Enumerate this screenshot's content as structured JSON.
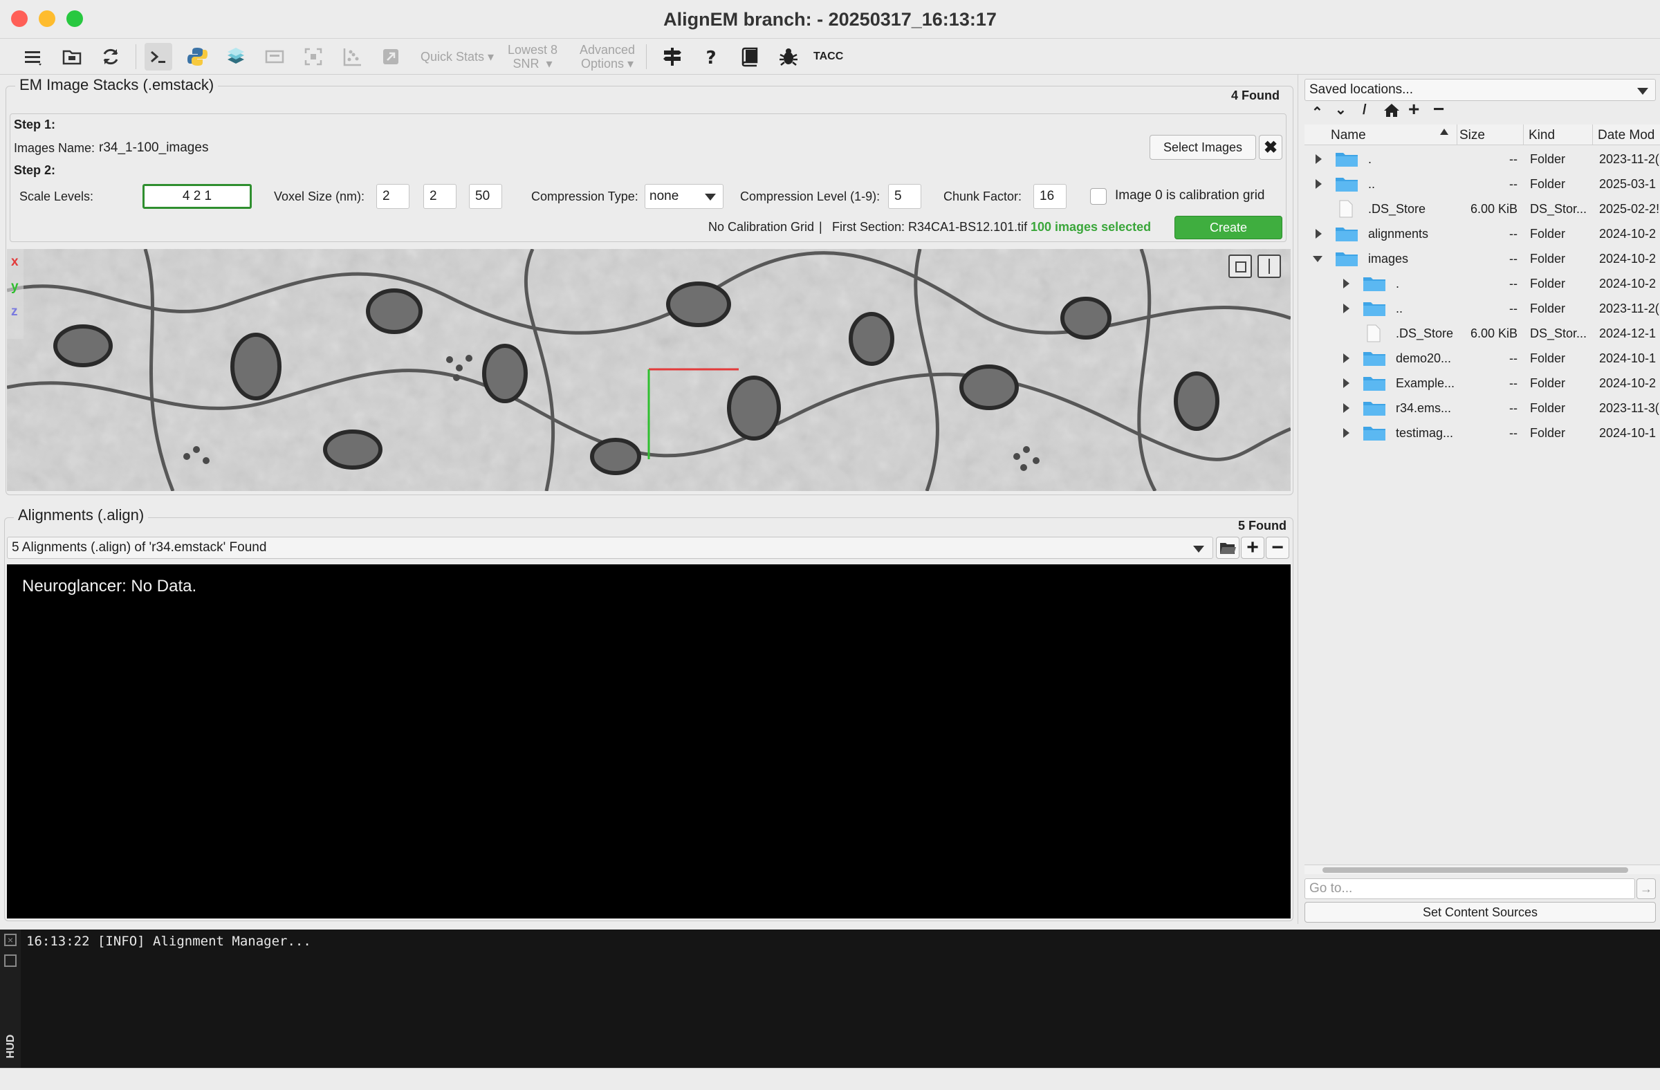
{
  "window": {
    "title": "AlignEM branch:  - 20250317_16:13:17",
    "lights": {
      "close": "#ff5f57",
      "minimize": "#febc2e",
      "maximize": "#28c840"
    }
  },
  "toolbar": {
    "quick_stats": "Quick Stats",
    "lowest_snr_line1": "Lowest 8",
    "lowest_snr_line2": "SNR",
    "advanced_line1": "Advanced",
    "advanced_line2": "Options",
    "tacc": "TACC"
  },
  "emstack": {
    "title": "EM Image Stacks (.emstack)",
    "found": "4 Found",
    "step1": "Step 1:",
    "images_name_label": "Images Name:",
    "images_name_value": "r34_1-100_images",
    "select_images": "Select Images",
    "step2": "Step 2:",
    "scale_levels_label": "Scale Levels:",
    "scale_levels_value": "4 2 1",
    "voxel_label": "Voxel Size (nm):",
    "voxel_x": "2",
    "voxel_y": "2",
    "voxel_z": "50",
    "compression_type_label": "Compression Type:",
    "compression_type_value": "none",
    "compression_level_label": "Compression Level (1-9):",
    "compression_level_value": "5",
    "chunk_label": "Chunk Factor:",
    "chunk_value": "16",
    "calib_checkbox_label": "Image 0 is calibration grid",
    "calib_checked": false,
    "status_calibration": "No Calibration Grid",
    "status_sep": "|",
    "status_first_section": "First Section: R34CA1-BS12.101.tif",
    "status_selected": "100 images selected",
    "create": "Create",
    "axes": {
      "x": "x",
      "y": "y",
      "z": "z"
    }
  },
  "alignments": {
    "title": "Alignments (.align)",
    "found": "5 Found",
    "combo_value": "5 Alignments (.align) of 'r34.emstack' Found",
    "neuroglancer_text": "Neuroglancer: No Data."
  },
  "hud": {
    "label": "HUD",
    "log": "16:13:22 [INFO] Alignment Manager..."
  },
  "browser": {
    "saved_locations": "Saved locations...",
    "columns": {
      "name": "Name",
      "size": "Size",
      "kind": "Kind",
      "date": "Date Mod"
    },
    "rows": [
      {
        "name": ".",
        "size": "--",
        "kind": "Folder",
        "date": "2023-11-2(",
        "type": "folder",
        "depth": 0,
        "expander": "closed"
      },
      {
        "name": "..",
        "size": "--",
        "kind": "Folder",
        "date": "2025-03-1",
        "type": "folder",
        "depth": 0,
        "expander": "closed"
      },
      {
        "name": ".DS_Store",
        "size": "6.00 KiB",
        "kind": "DS_Stor...",
        "date": "2025-02-2!",
        "type": "file",
        "depth": 0,
        "expander": "none"
      },
      {
        "name": "alignments",
        "size": "--",
        "kind": "Folder",
        "date": "2024-10-2",
        "type": "folder",
        "depth": 0,
        "expander": "closed"
      },
      {
        "name": "images",
        "size": "--",
        "kind": "Folder",
        "date": "2024-10-2",
        "type": "folder",
        "depth": 0,
        "expander": "open"
      },
      {
        "name": ".",
        "size": "--",
        "kind": "Folder",
        "date": "2024-10-2",
        "type": "folder",
        "depth": 1,
        "expander": "closed"
      },
      {
        "name": "..",
        "size": "--",
        "kind": "Folder",
        "date": "2023-11-2(",
        "type": "folder",
        "depth": 1,
        "expander": "closed"
      },
      {
        "name": ".DS_Store",
        "size": "6.00 KiB",
        "kind": "DS_Stor...",
        "date": "2024-12-1",
        "type": "file",
        "depth": 1,
        "expander": "none"
      },
      {
        "name": "demo20...",
        "size": "--",
        "kind": "Folder",
        "date": "2024-10-1",
        "type": "folder",
        "depth": 1,
        "expander": "closed"
      },
      {
        "name": "Example...",
        "size": "--",
        "kind": "Folder",
        "date": "2024-10-2",
        "type": "folder",
        "depth": 1,
        "expander": "closed"
      },
      {
        "name": "r34.ems...",
        "size": "--",
        "kind": "Folder",
        "date": "2023-11-3(",
        "type": "folder",
        "depth": 1,
        "expander": "closed"
      },
      {
        "name": "testimag...",
        "size": "--",
        "kind": "Folder",
        "date": "2024-10-1",
        "type": "folder",
        "depth": 1,
        "expander": "closed"
      }
    ],
    "goto_placeholder": "Go to...",
    "set_content_sources": "Set Content Sources"
  }
}
